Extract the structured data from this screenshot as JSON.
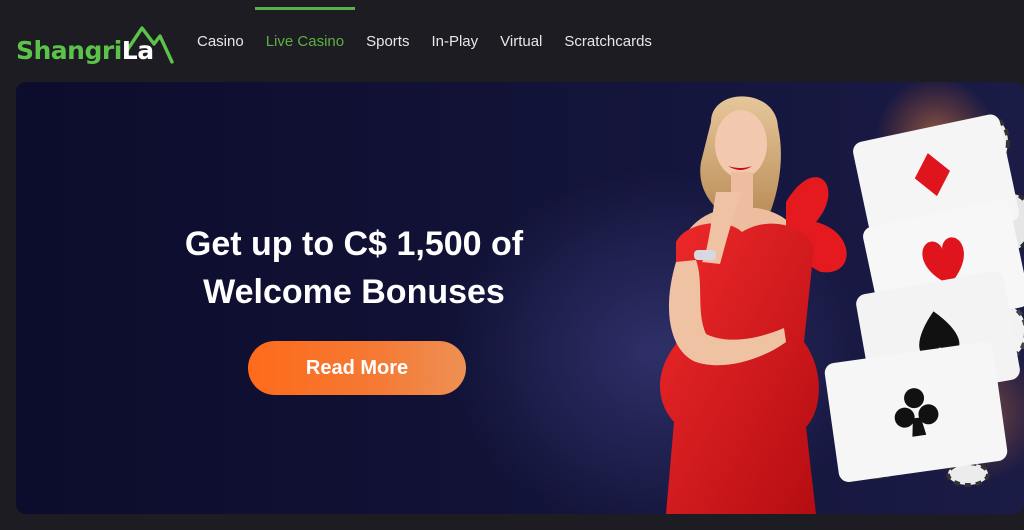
{
  "brand": {
    "name_part1": "Shangri",
    "name_part2": "La",
    "color_green": "#5cc34a",
    "logo_icon": "mountain-peak-icon"
  },
  "nav": {
    "items": [
      {
        "label": "Casino",
        "active": false
      },
      {
        "label": "Live Casino",
        "active": true
      },
      {
        "label": "Sports",
        "active": false
      },
      {
        "label": "In-Play",
        "active": false
      },
      {
        "label": "Virtual",
        "active": false
      },
      {
        "label": "Scratchcards",
        "active": false
      }
    ],
    "active_color": "#5cb043"
  },
  "hero": {
    "headline_line1": "Get up to C$ 1,500 of",
    "headline_line2": "Welcome Bonuses",
    "cta_label": "Read More",
    "cta_color": "#ff6a1a",
    "art": "woman-in-red-dress-with-playing-cards-and-chips"
  }
}
